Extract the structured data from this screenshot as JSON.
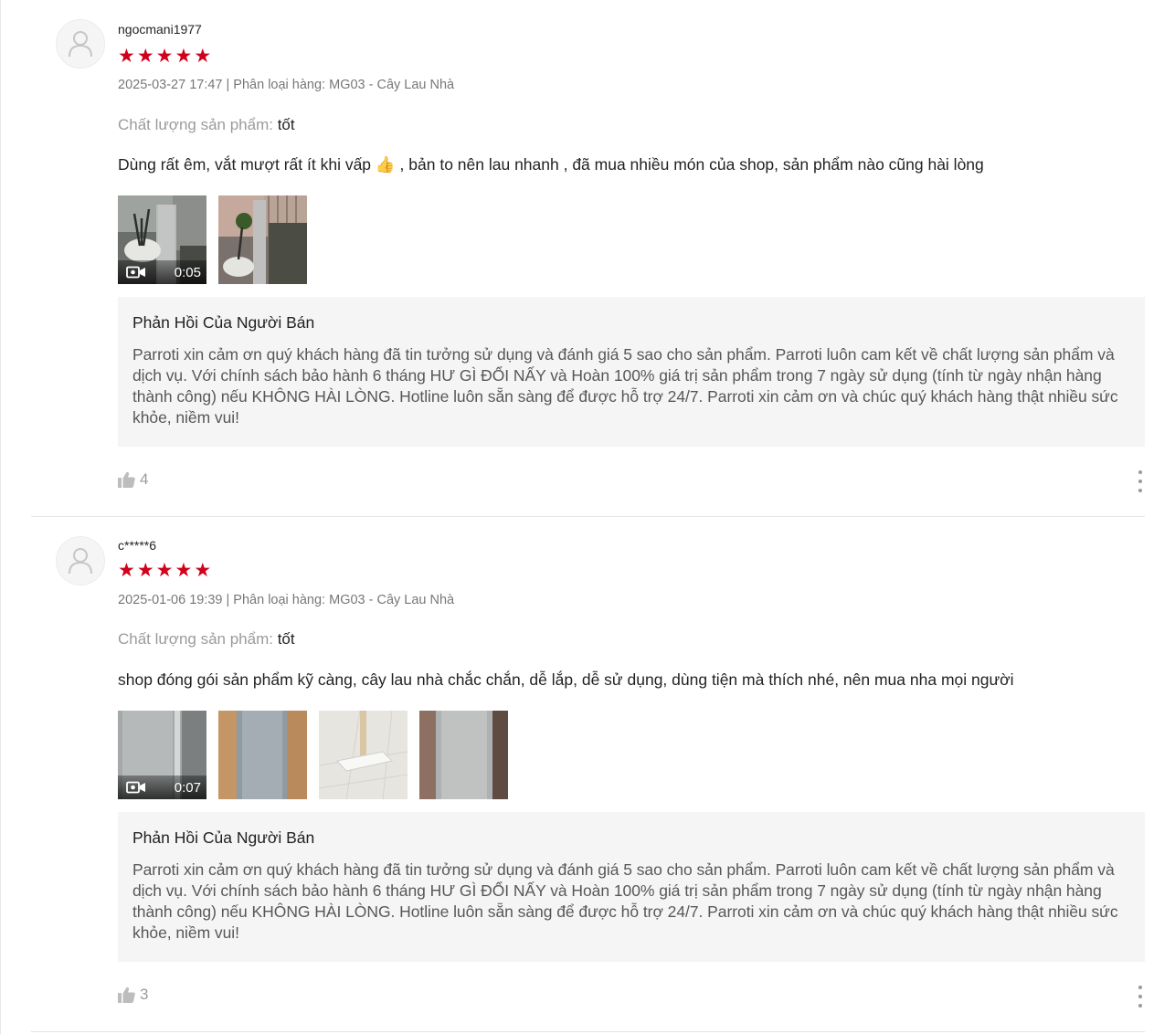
{
  "reviews": [
    {
      "username": "ngocmani1977",
      "rating": 5,
      "meta": "2025-03-27 17:47 | Phân loại hàng: MG03 - Cây Lau Nhà",
      "quality_label": "Chất lượng sản phẩm:",
      "quality_value": "tốt",
      "comment": "Dùng rất êm, vắt mượt rất ít khi vấp 👍 , bản to nên lau nhanh , đã mua nhiều món của shop, sản phẩm nào cũng hài lòng",
      "media": [
        {
          "type": "video",
          "duration": "0:05"
        },
        {
          "type": "image"
        }
      ],
      "reply_title": "Phản Hồi Của Người Bán",
      "reply_text": "Parroti xin cảm ơn quý khách hàng đã tin tưởng sử dụng và đánh giá 5 sao cho sản phẩm. Parroti luôn cam kết về chất lượng sản phẩm và dịch vụ. Với chính sách bảo hành 6 tháng HƯ GÌ ĐỔI NẤY và Hoàn 100% giá trị sản phẩm trong 7 ngày sử dụng (tính từ ngày nhận hàng thành công) nếu KHÔNG HÀI LÒNG. Hotline luôn sẵn sàng để được hỗ trợ 24/7. Parroti xin cảm ơn và chúc quý khách hàng thật nhiều sức khỏe, niềm vui!",
      "likes": "4"
    },
    {
      "username": "c*****6",
      "rating": 5,
      "meta": "2025-01-06 19:39 | Phân loại hàng: MG03 - Cây Lau Nhà",
      "quality_label": "Chất lượng sản phẩm:",
      "quality_value": "tốt",
      "comment": "shop đóng gói sản phẩm kỹ càng, cây lau nhà chắc chắn, dễ lắp, dễ sử dụng, dùng tiện mà thích nhé, nên mua nha mọi người",
      "media": [
        {
          "type": "video",
          "duration": "0:07"
        },
        {
          "type": "image"
        },
        {
          "type": "image"
        },
        {
          "type": "image"
        }
      ],
      "reply_title": "Phản Hồi Của Người Bán",
      "reply_text": "Parroti xin cảm ơn quý khách hàng đã tin tưởng sử dụng và đánh giá 5 sao cho sản phẩm. Parroti luôn cam kết về chất lượng sản phẩm và dịch vụ. Với chính sách bảo hành 6 tháng HƯ GÌ ĐỔI NẤY và Hoàn 100% giá trị sản phẩm trong 7 ngày sử dụng (tính từ ngày nhận hàng thành công) nếu KHÔNG HÀI LÒNG. Hotline  luôn sẵn sàng để được hỗ trợ 24/7. Parroti xin cảm ơn và chúc quý khách hàng thật nhiều sức khỏe, niềm vui!",
      "likes": "3"
    }
  ],
  "colors": {
    "star": "#d0011b",
    "reply_bg": "#f5f5f5",
    "muted": "#757575"
  }
}
